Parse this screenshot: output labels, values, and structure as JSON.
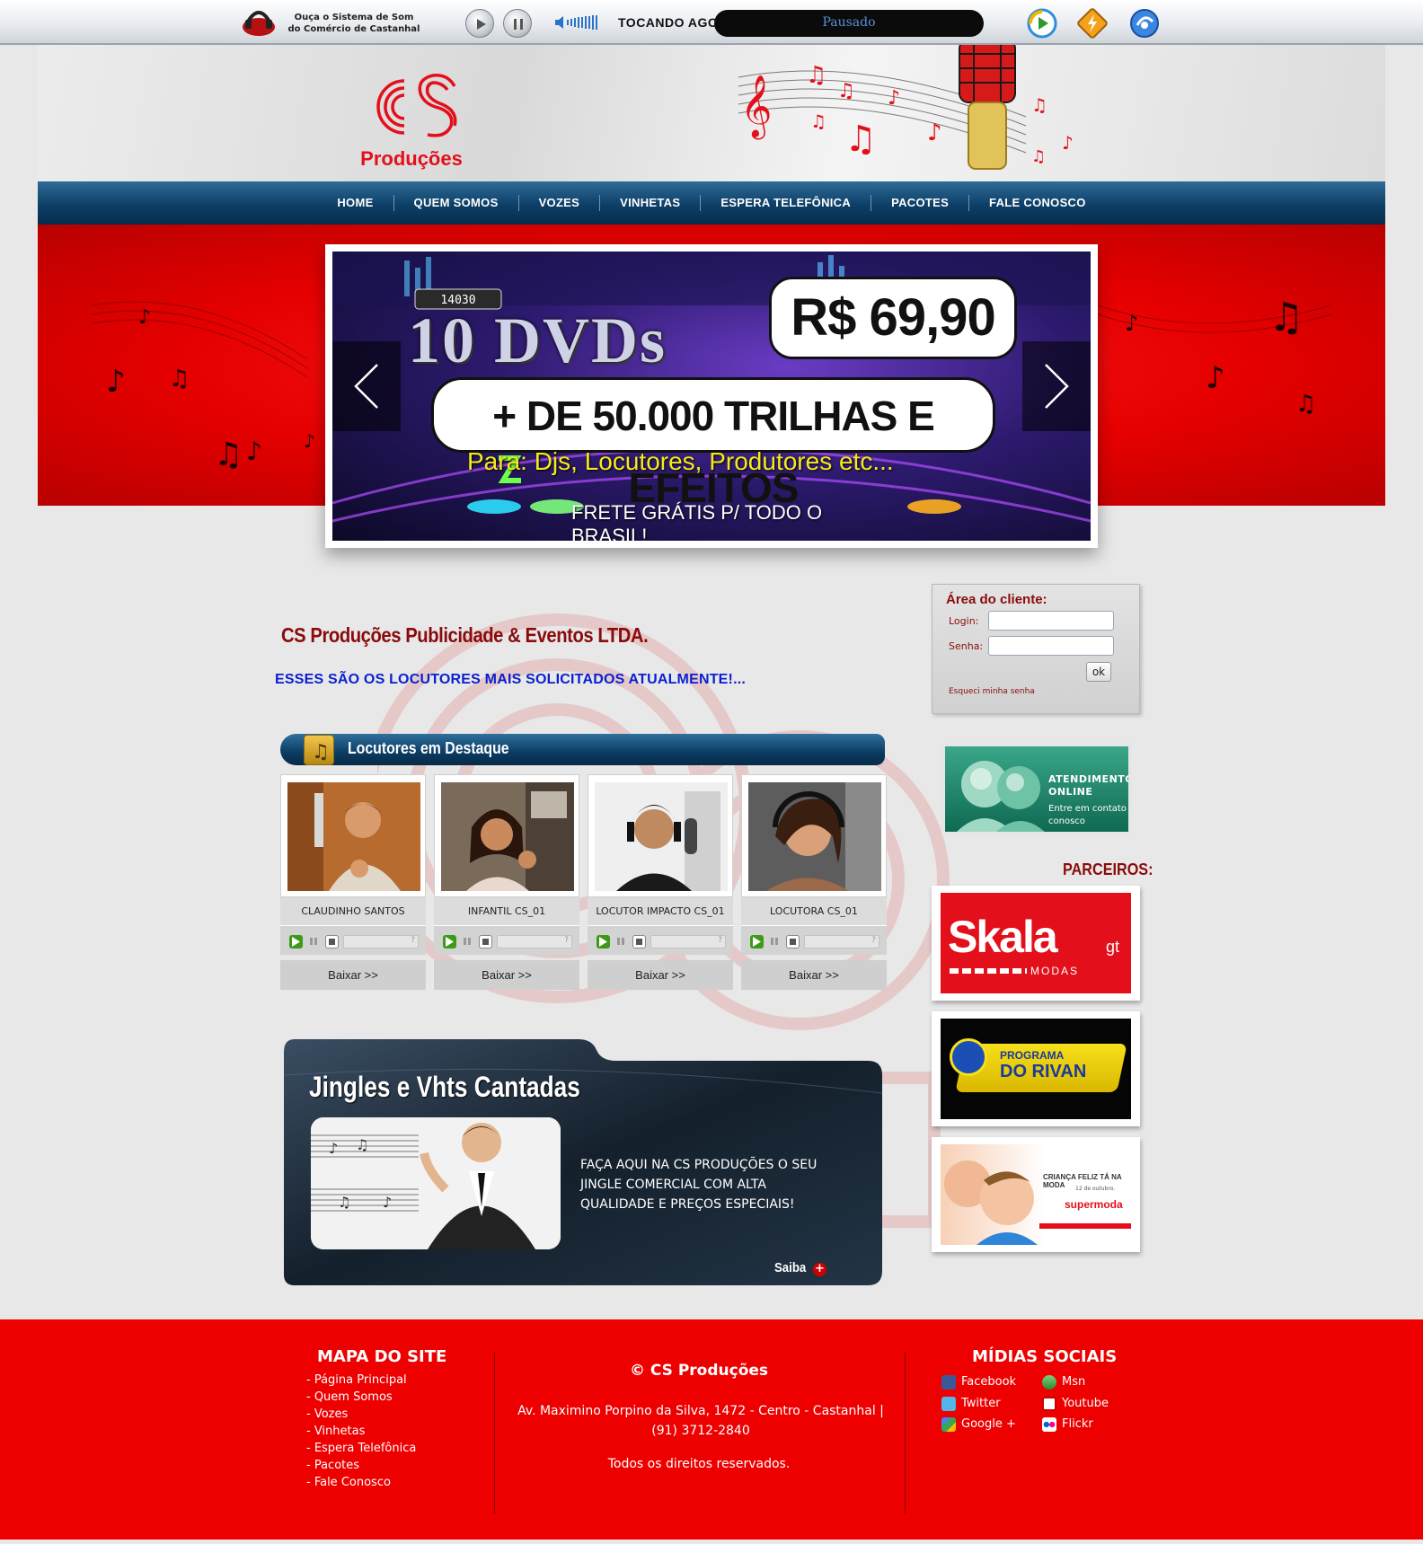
{
  "player": {
    "promo_line1": "Ouça o Sistema de Som",
    "promo_line2": "do Comércio de Castanhal",
    "now_playing_label": "TOCANDO AGORA:",
    "status": "Pausado"
  },
  "nav": {
    "items": [
      "HOME",
      "QUEM SOMOS",
      "VOZES",
      "VINHETAS",
      "ESPERA TELEFÔNICA",
      "PACOTES",
      "FALE CONOSCO"
    ]
  },
  "banner": {
    "dvds": "10 DVDs",
    "price": "R$ 69,90",
    "headline": "+ DE 50.000 TRILHAS E EFEITOS",
    "audience": "Para:  Djs,  Locutores,  Produtores  etc...",
    "shipping": "FRETE GRÁTIS P/ TODO O BRASIL!",
    "score": "14030"
  },
  "logo": {
    "text": "Produções"
  },
  "main": {
    "company_title": "CS Produções Publicidade & Eventos LTDA.",
    "subtitle": "ESSES SÃO OS LOCUTORES MAIS SOLICITADOS ATUALMENTE!..."
  },
  "client_area": {
    "title": "Área do cliente:",
    "login_label": "Login:",
    "password_label": "Senha:",
    "ok_label": "ok",
    "forgot_label": "Esqueci minha senha"
  },
  "support": {
    "title": "ATENDIMENTO ONLINE",
    "subtitle": "Entre em contato conosco"
  },
  "partners": {
    "title": "PARCEIROS:",
    "skala": "Skala",
    "skala_gt": "gt",
    "skala_sub": "MODAS",
    "rivan_line1": "PROGRAMA",
    "rivan_line2": "DO RIVAN",
    "supermoda_tag": "CRIANÇA FELIZ TÁ NA MODA",
    "supermoda_date": "12 de outubro.",
    "supermoda_brand": "supermoda"
  },
  "locutores": {
    "title": "Locutores em Destaque",
    "progress_hint": "?",
    "items": [
      {
        "name": "CLAUDINHO SANTOS",
        "download": "Baixar >>"
      },
      {
        "name": "INFANTIL CS_01",
        "download": "Baixar >>"
      },
      {
        "name": "LOCUTOR IMPACTO CS_01",
        "download": "Baixar >>"
      },
      {
        "name": "LOCUTORA CS_01",
        "download": "Baixar >>"
      }
    ]
  },
  "jingles": {
    "title": "Jingles e Vhts Cantadas",
    "text": "FAÇA AQUI NA CS PRODUÇÕES O SEU JINGLE COMERCIAL COM ALTA QUALIDADE E PREÇOS ESPECIAIS!",
    "cta": "Saiba",
    "cta_icon": "+"
  },
  "footer": {
    "sitemap_title": "MAPA DO SITE",
    "sitemap_items": [
      "- Página Principal",
      "- Quem Somos",
      "- Vozes",
      "- Vinhetas",
      "- Espera Telefônica",
      "- Pacotes",
      "- Fale Conosco"
    ],
    "copyright": "© CS Produções",
    "address": "Av. Maximino Porpino da Silva, 1472 - Centro - Castanhal | (91) 3712-2840",
    "rights": "Todos os direitos reservados.",
    "social_title": "MÍDIAS SOCIAIS",
    "social": {
      "facebook": "Facebook",
      "msn": "Msn",
      "twitter": "Twitter",
      "youtube": "Youtube",
      "google": "Google +",
      "flickr": "Flickr"
    }
  },
  "colors": {
    "brand_red": "#ee0000",
    "nav_blue": "#0d3f66",
    "title_red": "#8a0b0b",
    "subtitle_blue": "#0a1fd0"
  }
}
